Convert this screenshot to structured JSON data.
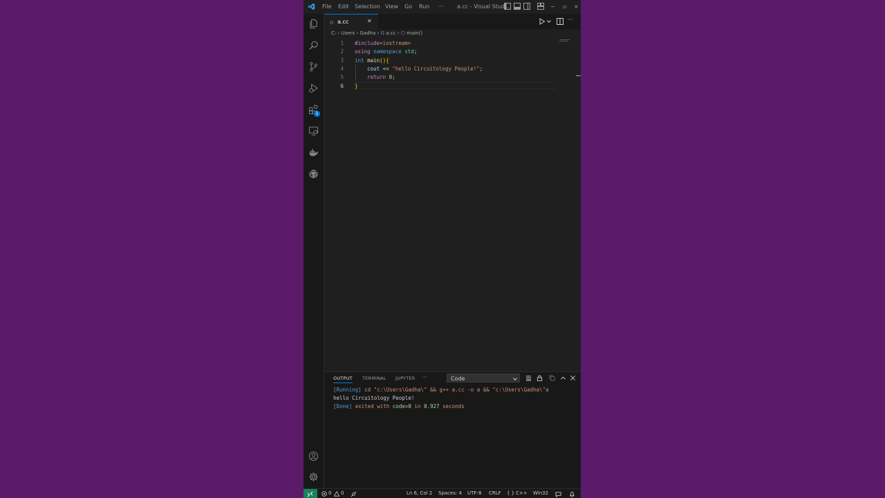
{
  "titlebar": {
    "menus": [
      "File",
      "Edit",
      "Selection",
      "View",
      "Go",
      "Run"
    ],
    "more": "···",
    "title": "a.cc - Visual Stud...",
    "min": "−",
    "max": "▫",
    "close": "×"
  },
  "tab": {
    "label": "a.cc",
    "close": "✕"
  },
  "breadcrumb": {
    "drive": "C:",
    "users": "Users",
    "user": "Gadha",
    "file": "a.cc",
    "symbol": "main()"
  },
  "editor": {
    "lines": [
      {
        "n": "1",
        "parts": [
          {
            "t": "#include",
            "c": "#c586c0"
          },
          {
            "t": "<iostream>",
            "c": "#ce9178"
          }
        ]
      },
      {
        "n": "2",
        "parts": [
          {
            "t": "using ",
            "c": "#c586c0"
          },
          {
            "t": "namespace ",
            "c": "#569cd6"
          },
          {
            "t": "std",
            "c": "#4ec9b0"
          },
          {
            "t": ";",
            "c": "#cccccc"
          }
        ]
      },
      {
        "n": "3",
        "parts": [
          {
            "t": "int ",
            "c": "#569cd6"
          },
          {
            "t": "main",
            "c": "#dcdcaa"
          },
          {
            "t": "()",
            "c": "#ffd700"
          },
          {
            "t": "{",
            "c": "#ffd700"
          }
        ]
      },
      {
        "n": "4",
        "parts": [
          {
            "t": "    cout ",
            "c": "#9cdcfe"
          },
          {
            "t": "<< ",
            "c": "#d4d4d4"
          },
          {
            "t": "\"hello Circuitology People!\"",
            "c": "#ce9178"
          },
          {
            "t": ";",
            "c": "#cccccc"
          }
        ]
      },
      {
        "n": "5",
        "parts": [
          {
            "t": "    return ",
            "c": "#c586c0"
          },
          {
            "t": "0",
            "c": "#b5cea8"
          },
          {
            "t": ";",
            "c": "#cccccc"
          }
        ]
      },
      {
        "n": "6",
        "parts": [
          {
            "t": "}",
            "c": "#ffd700"
          }
        ]
      }
    ]
  },
  "panel": {
    "tabs": [
      "OUTPUT",
      "TERMINAL",
      "JUPYTER"
    ],
    "more": "···",
    "channel": "Code",
    "output": {
      "line1_tag": "[Running]",
      "line1_cmd": " cd \"c:\\Users\\Gadha\\\" && g++ a.cc -o a && \"c:\\Users\\Gadha\\\"a",
      "line2": "hello Circuitology People!",
      "line3_tag": "[Done]",
      "line3_mid": " exited with ",
      "line3_code": "code=0",
      "line3_in": " in ",
      "line3_time": "0.927",
      "line3_end": " seconds"
    }
  },
  "activity": {
    "extensions_badge": "1"
  },
  "status": {
    "errors": "0",
    "warnings": "0",
    "position": "Ln 6, Col 2",
    "spaces": "Spaces: 4",
    "encoding": "UTF-8",
    "eol": "CRLF",
    "braces": "{ }",
    "language": "C++",
    "platform": "Win32"
  },
  "colors": {
    "page_bg": "#5c1a6b",
    "accent": "#0078d4",
    "remote": "#16825d"
  }
}
